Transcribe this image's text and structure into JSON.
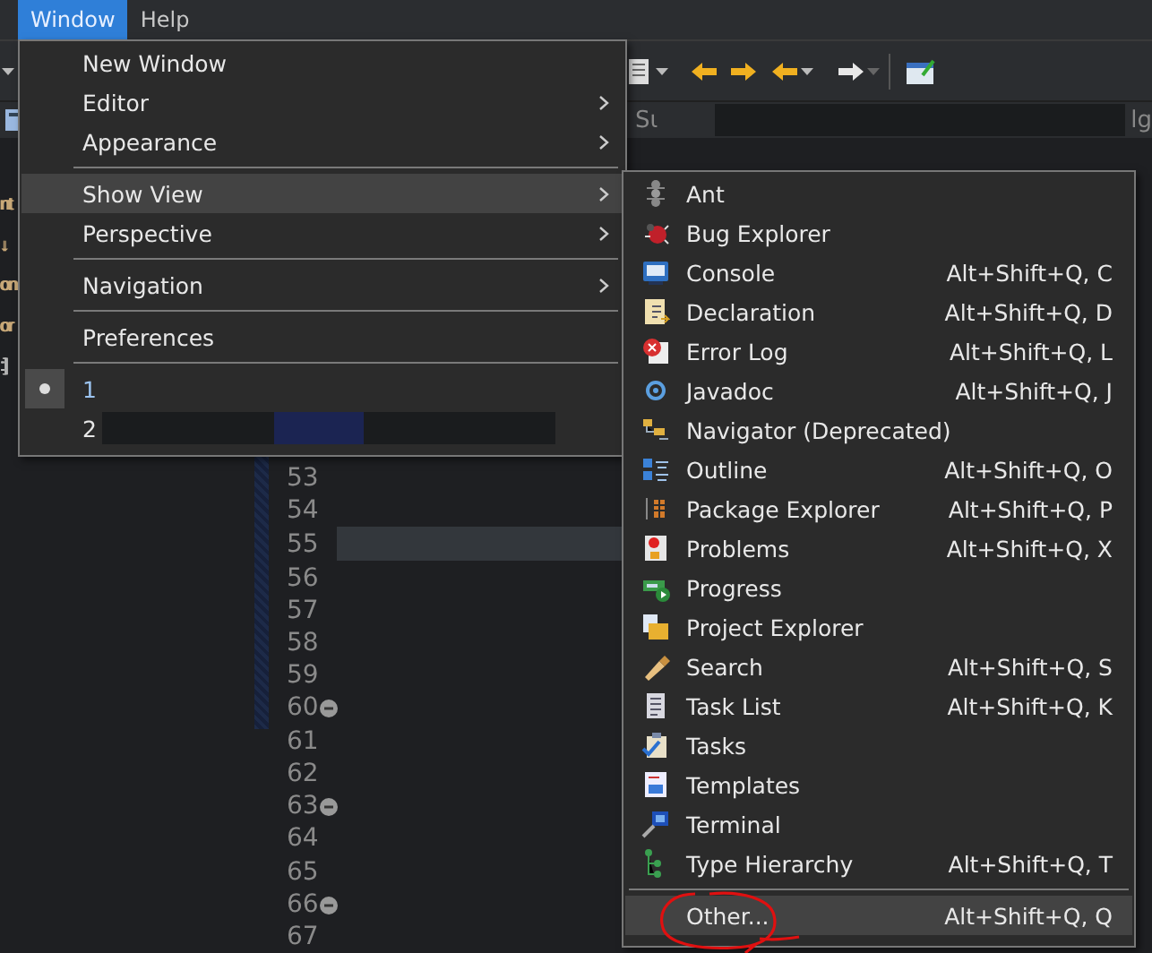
{
  "menubar": [
    {
      "label": "Window",
      "selected": true
    },
    {
      "label": "Help",
      "selected": false
    }
  ],
  "toolbar_row_2": {
    "tab_fragment": "Sι",
    "right_fragment": "lg"
  },
  "left_panel": {
    "fragments": [
      {
        "text": "nt",
        "color": "#c8a878"
      },
      {
        "text": "↓",
        "color": "#c8a878"
      },
      {
        "text": "on",
        "color": "#c8a878"
      },
      {
        "text": "or",
        "color": "#c8a878"
      },
      {
        "text": ":]",
        "color": "#b8b8b8"
      }
    ]
  },
  "editor": {
    "lines": [
      {
        "number": "53",
        "foldable": false,
        "current": false
      },
      {
        "number": "54",
        "foldable": false,
        "current": false
      },
      {
        "number": "55",
        "foldable": false,
        "current": true
      },
      {
        "number": "56",
        "foldable": false,
        "current": false
      },
      {
        "number": "57",
        "foldable": false,
        "current": false
      },
      {
        "number": "58",
        "foldable": false,
        "current": false
      },
      {
        "number": "59",
        "foldable": false,
        "current": false
      },
      {
        "number": "60",
        "foldable": true,
        "current": false
      },
      {
        "number": "61",
        "foldable": false,
        "current": false
      },
      {
        "number": "62",
        "foldable": false,
        "current": false
      },
      {
        "number": "63",
        "foldable": true,
        "current": false
      },
      {
        "number": "64",
        "foldable": false,
        "current": false
      },
      {
        "number": "65",
        "foldable": false,
        "current": false
      },
      {
        "number": "66",
        "foldable": true,
        "current": false
      },
      {
        "number": "67",
        "foldable": false,
        "current": false
      }
    ]
  },
  "window_menu": {
    "items": [
      {
        "kind": "item",
        "label": "New Window",
        "submenu": false,
        "selected": false
      },
      {
        "kind": "item",
        "label": "Editor",
        "submenu": true,
        "selected": false
      },
      {
        "kind": "item",
        "label": "Appearance",
        "submenu": true,
        "selected": false
      },
      {
        "kind": "separator"
      },
      {
        "kind": "item",
        "label": "Show View",
        "submenu": true,
        "selected": true
      },
      {
        "kind": "item",
        "label": "Perspective",
        "submenu": true,
        "selected": false
      },
      {
        "kind": "separator"
      },
      {
        "kind": "item",
        "label": "Navigation",
        "submenu": true,
        "selected": false
      },
      {
        "kind": "separator"
      },
      {
        "kind": "item",
        "label": "Preferences",
        "submenu": false,
        "selected": false
      },
      {
        "kind": "separator"
      },
      {
        "kind": "recent",
        "label": "1",
        "checked": true,
        "redacted": false
      },
      {
        "kind": "recent",
        "label": "2",
        "checked": false,
        "redacted": true
      }
    ]
  },
  "show_view_menu": {
    "items": [
      {
        "kind": "item",
        "label": "Ant",
        "selected": false
      },
      {
        "kind": "item",
        "label": "Bug Explorer",
        "selected": false
      },
      {
        "kind": "item",
        "label": "Console",
        "shortcut": "Alt+Shift+Q, C",
        "selected": false
      },
      {
        "kind": "item",
        "label": "Declaration",
        "shortcut": "Alt+Shift+Q, D",
        "selected": false
      },
      {
        "kind": "item",
        "label": "Error Log",
        "shortcut": "Alt+Shift+Q, L",
        "selected": false
      },
      {
        "kind": "item",
        "label": "Javadoc",
        "shortcut": "Alt+Shift+Q, J",
        "selected": false
      },
      {
        "kind": "item",
        "label": "Navigator (Deprecated)",
        "selected": false
      },
      {
        "kind": "item",
        "label": "Outline",
        "shortcut": "Alt+Shift+Q, O",
        "selected": false
      },
      {
        "kind": "item",
        "label": "Package Explorer",
        "shortcut": "Alt+Shift+Q, P",
        "selected": false
      },
      {
        "kind": "item",
        "label": "Problems",
        "shortcut": "Alt+Shift+Q, X",
        "selected": false
      },
      {
        "kind": "item",
        "label": "Progress",
        "selected": false
      },
      {
        "kind": "item",
        "label": "Project Explorer",
        "selected": false
      },
      {
        "kind": "item",
        "label": "Search",
        "shortcut": "Alt+Shift+Q, S",
        "selected": false
      },
      {
        "kind": "item",
        "label": "Task List",
        "shortcut": "Alt+Shift+Q, K",
        "selected": false
      },
      {
        "kind": "item",
        "label": "Tasks",
        "selected": false
      },
      {
        "kind": "item",
        "label": "Templates",
        "selected": false
      },
      {
        "kind": "item",
        "label": "Terminal",
        "selected": false
      },
      {
        "kind": "item",
        "label": "Type Hierarchy",
        "shortcut": "Alt+Shift+Q, T",
        "selected": false
      },
      {
        "kind": "separator"
      },
      {
        "kind": "item",
        "label": "Other...",
        "shortcut": "Alt+Shift+Q, Q",
        "selected": true
      }
    ]
  }
}
